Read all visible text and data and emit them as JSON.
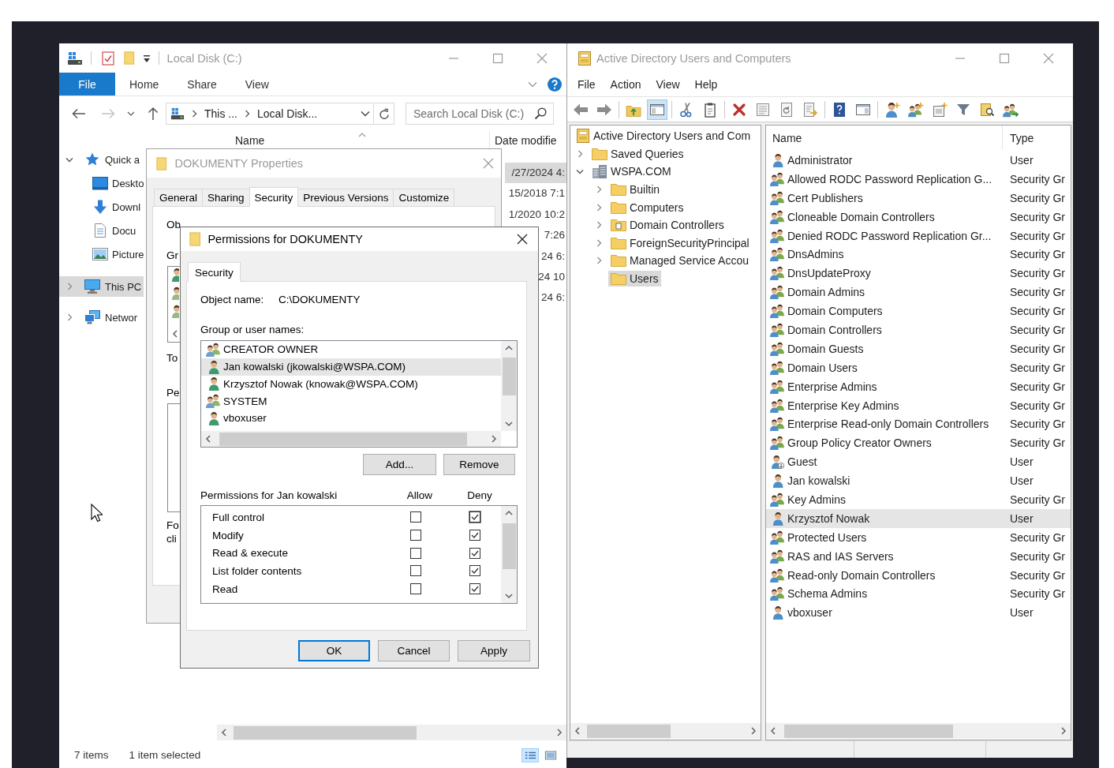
{
  "explorer": {
    "title": "Local Disk (C:)",
    "ribbon_tabs": [
      {
        "label": "File",
        "kind": "menu"
      },
      {
        "label": "Home",
        "kind": "tab"
      },
      {
        "label": "Share",
        "kind": "tab"
      },
      {
        "label": "View",
        "kind": "tab"
      }
    ],
    "address": {
      "segments": [
        "This ...",
        "Local Disk..."
      ]
    },
    "search": {
      "placeholder": "Search Local Disk (C:)"
    },
    "nav": [
      {
        "label": "Quick a",
        "kind": "quick-access",
        "expanded": true,
        "selected": false,
        "children": [
          {
            "label": "Deskto",
            "kind": "desktop",
            "selected": false
          },
          {
            "label": "Downl",
            "kind": "downloads",
            "selected": false
          },
          {
            "label": "Docu",
            "kind": "documents",
            "selected": false
          },
          {
            "label": "Picture",
            "kind": "pictures",
            "selected": false
          }
        ]
      },
      {
        "label": "This PC",
        "kind": "computer",
        "expanded": false,
        "selected": true
      },
      {
        "label": "Networ",
        "kind": "network",
        "expanded": false,
        "selected": false
      }
    ],
    "columns": [
      "Name",
      "Date modifie"
    ],
    "rows": [
      {
        "column_2": "/27/2024 4:",
        "selected": true
      },
      {
        "column_2": "15/2018 7:1",
        "selected": false
      },
      {
        "column_2": "1/2020 10:2",
        "selected": false
      },
      {
        "column_2": "7:26",
        "selected": false
      },
      {
        "column_2": "24 6:",
        "selected": false
      },
      {
        "column_2": "24 10",
        "selected": false
      },
      {
        "column_2": "24 6:",
        "selected": false
      }
    ],
    "status_bar": {
      "items": "7 items",
      "selection": "1 item selected"
    },
    "view_buttons": [
      {
        "kind": "details",
        "selected": true
      },
      {
        "kind": "large-icons",
        "selected": false
      }
    ]
  },
  "properties_dialog": {
    "title": "DOKUMENTY Properties",
    "tabs": [
      {
        "label": "General",
        "selected": false
      },
      {
        "label": "Sharing",
        "selected": false
      },
      {
        "label": "Security",
        "selected": true
      },
      {
        "label": "Previous Versions",
        "selected": false
      },
      {
        "label": "Customize",
        "selected": false
      }
    ],
    "label_stubs": [
      "Ob",
      "Gr",
      "To",
      "Pe",
      "Fo",
      "cli"
    ]
  },
  "permissions_dialog": {
    "title": "Permissions for DOKUMENTY",
    "tabs": [
      {
        "label": "Security",
        "selected": true
      }
    ],
    "object_name": {
      "label": "Object name:",
      "value": "C:\\DOKUMENTY"
    },
    "principals_label": "Group or user names:",
    "principals": [
      {
        "name": "CREATOR OWNER",
        "kind": "group",
        "selected": false
      },
      {
        "name": "Jan kowalski (jkowalski@WSPA.COM)",
        "kind": "user",
        "selected": true
      },
      {
        "name": "Krzysztof Nowak (knowak@WSPA.COM)",
        "kind": "user",
        "selected": false
      },
      {
        "name": "SYSTEM",
        "kind": "group",
        "selected": false
      },
      {
        "name": "vboxuser",
        "kind": "user",
        "selected": false
      }
    ],
    "principal_buttons": [
      "Add...",
      "Remove"
    ],
    "permissions_label": "Permissions for Jan kowalski",
    "permission_columns": [
      "Allow",
      "Deny"
    ],
    "permissions": [
      {
        "name": "Full control",
        "allow": {
          "checked": false,
          "focused": false
        },
        "deny": {
          "checked": true,
          "focused": true
        }
      },
      {
        "name": "Modify",
        "allow": {
          "checked": false,
          "focused": false
        },
        "deny": {
          "checked": true,
          "focused": false
        }
      },
      {
        "name": "Read & execute",
        "allow": {
          "checked": false,
          "focused": false
        },
        "deny": {
          "checked": true,
          "focused": false
        }
      },
      {
        "name": "List folder contents",
        "allow": {
          "checked": false,
          "focused": false
        },
        "deny": {
          "checked": true,
          "focused": false
        }
      },
      {
        "name": "Read",
        "allow": {
          "checked": false,
          "focused": false
        },
        "deny": {
          "checked": true,
          "focused": false
        }
      }
    ],
    "buttons": [
      {
        "label": "OK",
        "default": true
      },
      {
        "label": "Cancel",
        "default": false
      },
      {
        "label": "Apply",
        "default": false
      }
    ]
  },
  "aduc": {
    "title": "Active Directory Users and Computers",
    "menu": [
      "File",
      "Action",
      "View",
      "Help"
    ],
    "toolbar": [
      [
        {
          "kind": "back",
          "pressed": false
        },
        {
          "kind": "forward",
          "pressed": false
        }
      ],
      [
        {
          "kind": "up",
          "pressed": false
        },
        {
          "kind": "console-tree",
          "pressed": true
        }
      ],
      [
        {
          "kind": "cut",
          "pressed": false
        },
        {
          "kind": "copy",
          "pressed": false
        }
      ],
      [
        {
          "kind": "delete",
          "pressed": false
        },
        {
          "kind": "properties",
          "pressed": false
        },
        {
          "kind": "refresh",
          "pressed": false
        },
        {
          "kind": "export",
          "pressed": false
        }
      ],
      [
        {
          "kind": "help",
          "pressed": false
        },
        {
          "kind": "action-pane",
          "pressed": false
        }
      ],
      [
        {
          "kind": "new-user",
          "pressed": false
        },
        {
          "kind": "new-group",
          "pressed": false
        },
        {
          "kind": "new-ou",
          "pressed": false
        },
        {
          "kind": "filter",
          "pressed": false
        },
        {
          "kind": "find",
          "pressed": false
        },
        {
          "kind": "add-to-group",
          "pressed": false
        }
      ]
    ],
    "tree": [
      {
        "label": "Active Directory Users and Com",
        "kind": "console-root",
        "selected": false,
        "children": [
          {
            "label": "Saved Queries",
            "kind": "folder",
            "expanded": false,
            "selected": false
          },
          {
            "label": "WSPA.COM",
            "kind": "domain",
            "expanded": true,
            "selected": false,
            "children": [
              {
                "label": "Builtin",
                "kind": "folder",
                "expanded": false,
                "selected": false
              },
              {
                "label": "Computers",
                "kind": "folder",
                "expanded": false,
                "selected": false
              },
              {
                "label": "Domain Controllers",
                "kind": "ou",
                "expanded": false,
                "selected": false
              },
              {
                "label": "ForeignSecurityPrincipal",
                "kind": "folder",
                "expanded": false,
                "selected": false
              },
              {
                "label": "Managed Service Accou",
                "kind": "folder",
                "expanded": false,
                "selected": false
              },
              {
                "label": "Users",
                "kind": "folder",
                "selected": true
              }
            ]
          }
        ]
      }
    ],
    "columns": [
      "Name",
      "Type"
    ],
    "rows": [
      {
        "name": "Administrator",
        "type": "User",
        "kind": "user",
        "selected": false
      },
      {
        "name": "Allowed RODC Password Replication G...",
        "type": "Security Gr",
        "kind": "group",
        "selected": false
      },
      {
        "name": "Cert Publishers",
        "type": "Security Gr",
        "kind": "group",
        "selected": false
      },
      {
        "name": "Cloneable Domain Controllers",
        "type": "Security Gr",
        "kind": "group",
        "selected": false
      },
      {
        "name": "Denied RODC Password Replication Gr...",
        "type": "Security Gr",
        "kind": "group",
        "selected": false
      },
      {
        "name": "DnsAdmins",
        "type": "Security Gr",
        "kind": "group",
        "selected": false
      },
      {
        "name": "DnsUpdateProxy",
        "type": "Security Gr",
        "kind": "group",
        "selected": false
      },
      {
        "name": "Domain Admins",
        "type": "Security Gr",
        "kind": "group",
        "selected": false
      },
      {
        "name": "Domain Computers",
        "type": "Security Gr",
        "kind": "group",
        "selected": false
      },
      {
        "name": "Domain Controllers",
        "type": "Security Gr",
        "kind": "group",
        "selected": false
      },
      {
        "name": "Domain Guests",
        "type": "Security Gr",
        "kind": "group",
        "selected": false
      },
      {
        "name": "Domain Users",
        "type": "Security Gr",
        "kind": "group",
        "selected": false
      },
      {
        "name": "Enterprise Admins",
        "type": "Security Gr",
        "kind": "group",
        "selected": false
      },
      {
        "name": "Enterprise Key Admins",
        "type": "Security Gr",
        "kind": "group",
        "selected": false
      },
      {
        "name": "Enterprise Read-only Domain Controllers",
        "type": "Security Gr",
        "kind": "group",
        "selected": false
      },
      {
        "name": "Group Policy Creator Owners",
        "type": "Security Gr",
        "kind": "group",
        "selected": false
      },
      {
        "name": "Guest",
        "type": "User",
        "kind": "disabled-user",
        "selected": false
      },
      {
        "name": "Jan kowalski",
        "type": "User",
        "kind": "user",
        "selected": false
      },
      {
        "name": "Key Admins",
        "type": "Security Gr",
        "kind": "group",
        "selected": false
      },
      {
        "name": "Krzysztof Nowak",
        "type": "User",
        "kind": "user",
        "selected": true
      },
      {
        "name": "Protected Users",
        "type": "Security Gr",
        "kind": "group",
        "selected": false
      },
      {
        "name": "RAS and IAS Servers",
        "type": "Security Gr",
        "kind": "group",
        "selected": false
      },
      {
        "name": "Read-only Domain Controllers",
        "type": "Security Gr",
        "kind": "group",
        "selected": false
      },
      {
        "name": "Schema Admins",
        "type": "Security Gr",
        "kind": "group",
        "selected": false
      },
      {
        "name": "vboxuser",
        "type": "User",
        "kind": "user",
        "selected": false
      }
    ]
  }
}
